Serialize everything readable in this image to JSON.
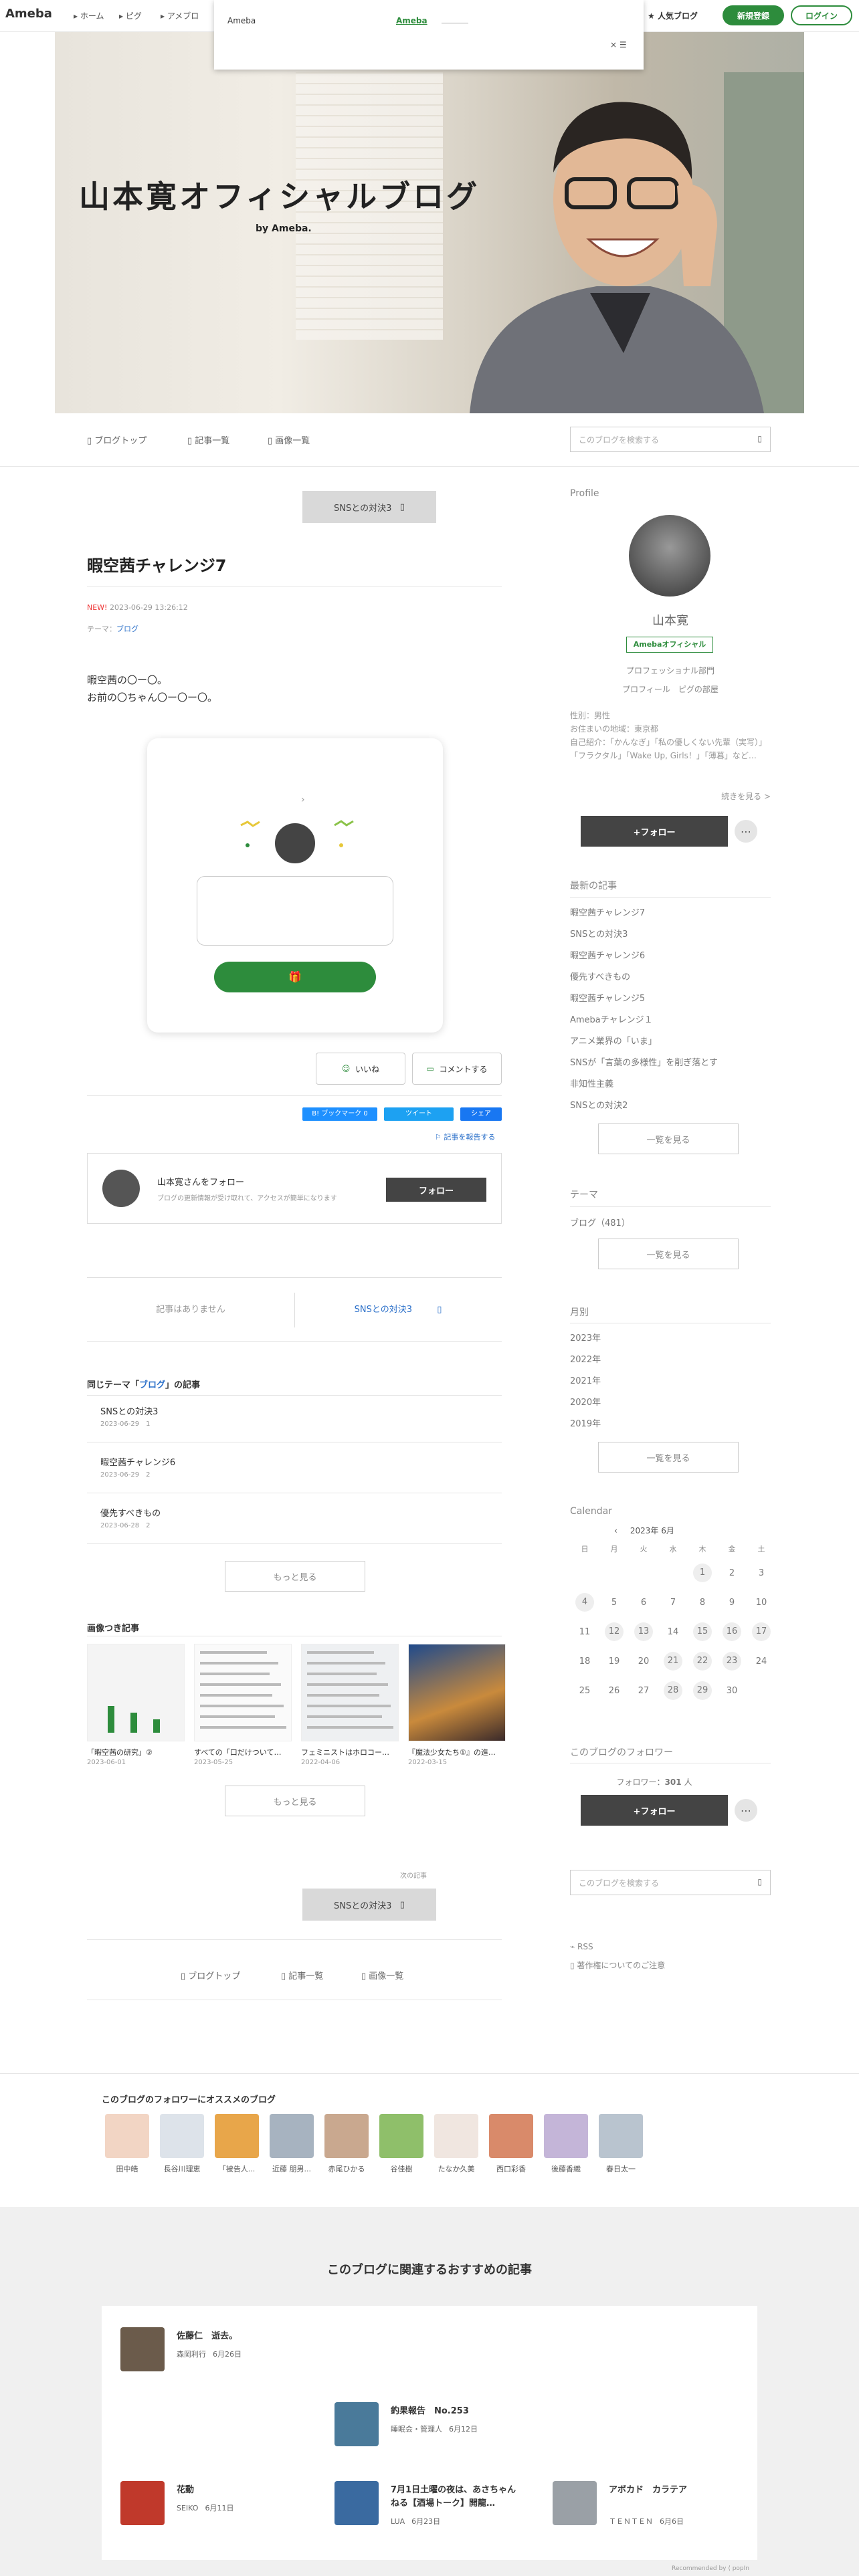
{
  "header": {
    "logo": "Ameba",
    "nav": [
      "ホーム",
      "ピグ",
      "アメブロ"
    ],
    "popup_title": "Ameba",
    "popup_link": "Ameba",
    "popup_close": "× ☰",
    "ranking": "人気ブログ",
    "signup": "新規登録",
    "login": "ログイン"
  },
  "hero": {
    "title": "山本寛オフィシャルブログ",
    "by": "by Ameba."
  },
  "tabs": {
    "top": "ブログトップ",
    "list": "記事一覧",
    "images": "画像一覧",
    "search_placeholder": "このブログを検索する"
  },
  "article": {
    "next_label": "SNSとの対決3",
    "title": "暇空茜チャレンジ7",
    "new": "NEW!",
    "date": "2023-06-29 13:26:12",
    "theme_label": "テーマ：",
    "theme": "ブログ",
    "body1": "暇空茜の〇ー〇。",
    "body2": "お前の〇ちゃん〇ー〇ー〇。",
    "like": "いいね",
    "comment": "コメントする",
    "bookmark": "B! ブックマーク 0",
    "tweet": "ツイート",
    "share": "シェア",
    "report": "記事を報告する",
    "follow_title": "山本寛さんをフォロー",
    "follow_desc": "ブログの更新情報が受け取れて、アクセスが簡単になります",
    "follow_btn": "フォロー",
    "no_article": "記事はありません",
    "next_article": "SNSとの対決3"
  },
  "same_theme": {
    "heading_pre": "同じテーマ「",
    "heading_theme": "ブログ",
    "heading_post": "」の記事",
    "items": [
      {
        "title": "SNSとの対決3",
        "date": "2023-06-29",
        "count": "1"
      },
      {
        "title": "暇空茜チャレンジ6",
        "date": "2023-06-29",
        "count": "2"
      },
      {
        "title": "優先すべきもの",
        "date": "2023-06-28",
        "count": "2"
      }
    ],
    "more": "もっと見る"
  },
  "image_articles": {
    "heading": "画像つき記事",
    "items": [
      {
        "title": "「暇空茜の研究」②",
        "date": "2023-06-01"
      },
      {
        "title": "すべての「口だけついて…",
        "date": "2023-05-25"
      },
      {
        "title": "フェミニストはホロコー…",
        "date": "2022-04-06"
      },
      {
        "title": "『魔法少女たち①』の進…",
        "date": "2022-03-15"
      }
    ],
    "more": "もっと見る",
    "next_small": "次の記事",
    "next_btn": "SNSとの対決3"
  },
  "footer_tabs": {
    "top": "ブログトップ",
    "list": "記事一覧",
    "images": "画像一覧"
  },
  "profile": {
    "heading": "Profile",
    "name": "山本寛",
    "badge": "Amebaオフィシャル",
    "dept": "プロフェッショナル部門",
    "links": "プロフィール　ピグの部屋",
    "sex": "性別：男性",
    "home": "お住まいの地域：東京都",
    "intro": "自己紹介：「かんなぎ」「私の優しくない先輩（実写）」「フラクタル」「Wake Up, Girls！」「薄暮」など…",
    "more": "続きを見る >",
    "follow": "+フォロー"
  },
  "latest": {
    "heading": "最新の記事",
    "items": [
      "暇空茜チャレンジ7",
      "SNSとの対決3",
      "暇空茜チャレンジ6",
      "優先すべきもの",
      "暇空茜チャレンジ5",
      "Amebaチャレンジ１",
      "アニメ業界の「いま」",
      "SNSが「言葉の多様性」を削ぎ落とす",
      "非知性主義",
      "SNSとの対決2"
    ],
    "more": "一覧を見る"
  },
  "theme": {
    "heading": "テーマ",
    "item": "ブログ（481）",
    "more": "一覧を見る"
  },
  "monthly": {
    "heading": "月別",
    "items": [
      "2023年",
      "2022年",
      "2021年",
      "2020年",
      "2019年"
    ],
    "more": "一覧を見る"
  },
  "calendar": {
    "heading": "Calendar",
    "month": "2023年 6月",
    "days": [
      "日",
      "月",
      "火",
      "水",
      "木",
      "金",
      "土"
    ],
    "weeks": [
      [
        "",
        "",
        "",
        "",
        "1",
        "2",
        "3"
      ],
      [
        "4",
        "5",
        "6",
        "7",
        "8",
        "9",
        "10"
      ],
      [
        "11",
        "12",
        "13",
        "14",
        "15",
        "16",
        "17"
      ],
      [
        "18",
        "19",
        "20",
        "21",
        "22",
        "23",
        "24"
      ],
      [
        "25",
        "26",
        "27",
        "28",
        "29",
        "30",
        ""
      ]
    ],
    "posted": [
      "1",
      "4",
      "12",
      "13",
      "15",
      "16",
      "17",
      "21",
      "22",
      "23",
      "28",
      "29"
    ]
  },
  "followers": {
    "heading": "このブログのフォロワー",
    "count_label": "フォロワー：",
    "count": "301",
    "unit": "人",
    "follow": "+フォロー"
  },
  "side_bottom": {
    "search_placeholder": "このブログを検索する",
    "rss": "RSS",
    "copyright": "著作権についてのご注意"
  },
  "recommend": {
    "heading": "このブログのフォロワーにオススメのブログ",
    "names": [
      "田中皓",
      "長谷川理恵",
      "「被告人...",
      "近藤 朋男...",
      "赤尾ひかる",
      "谷佳樹",
      "たなか久美",
      "西口彩香",
      "後藤香織",
      "春日太一"
    ]
  },
  "related": {
    "heading": "このブログに関連するおすすめの記事",
    "items": [
      {
        "title": "佐藤仁　逝去。",
        "author": "森岡利行",
        "date": "6月26日"
      },
      {
        "title": "釣果報告　No.253",
        "author": "睡眠会・管理人",
        "date": "6月12日"
      },
      {
        "title": "花動",
        "author": "SEIKO",
        "date": "6月11日"
      },
      {
        "title": "7月1日土曜の夜は、あさちゃんねる【酒場トーク】開龍…",
        "author": "LUA",
        "date": "6月23日"
      },
      {
        "title": "アボカド　カラテア",
        "author": "ＴＥＮＴＥＮ",
        "date": "6月6日"
      }
    ],
    "powered": "Recommended by ⟨ popIn"
  }
}
